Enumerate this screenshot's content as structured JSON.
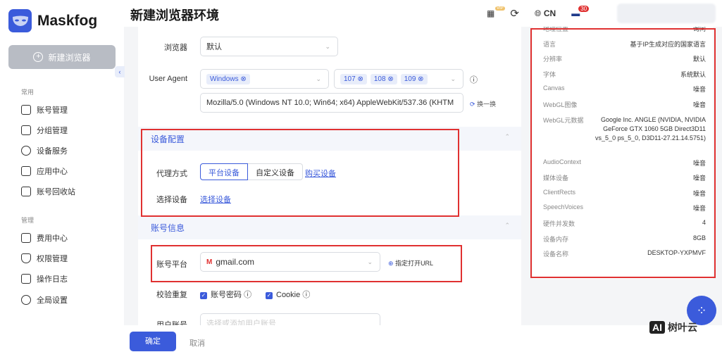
{
  "app": {
    "name": "Maskfog",
    "new_browser": "新建浏览器"
  },
  "sidebar": {
    "groups": [
      {
        "label": "常用",
        "items": [
          {
            "label": "账号管理"
          },
          {
            "label": "分组管理"
          },
          {
            "label": "设备服务"
          },
          {
            "label": "应用中心"
          },
          {
            "label": "账号回收站"
          }
        ]
      },
      {
        "label": "管理",
        "items": [
          {
            "label": "费用中心"
          },
          {
            "label": "权限管理"
          },
          {
            "label": "操作日志"
          },
          {
            "label": "全局设置"
          }
        ]
      }
    ]
  },
  "header": {
    "title": "新建浏览器环境",
    "vip": "VIP",
    "language": "CN",
    "notifications": "30"
  },
  "form": {
    "browser": {
      "label": "浏览器",
      "value": "默认"
    },
    "user_agent": {
      "label": "User Agent",
      "os_tags": [
        "Windows"
      ],
      "version_tags": [
        "107",
        "108",
        "109"
      ],
      "value": "Mozilla/5.0 (Windows NT 10.0; Win64; x64) AppleWebKit/537.36 (KHTM",
      "refresh": "换一换"
    },
    "device_section": {
      "title": "设备配置",
      "proxy_label": "代理方式",
      "options": [
        "平台设备",
        "自定义设备"
      ],
      "buy": "购买设备",
      "select_label": "选择设备",
      "select_link": "选择设备"
    },
    "account_section": {
      "title": "账号信息",
      "platform_label": "账号平台",
      "platform_value": "gmail.com",
      "open_url": "指定打开URL",
      "dup_label": "校验重复",
      "dup_options": [
        "账号密码",
        "Cookie"
      ],
      "user_label": "用户账号",
      "user_placeholder": "选择或添加用户账号"
    }
  },
  "footer": {
    "ok": "确定",
    "cancel": "取消"
  },
  "fingerprint": [
    {
      "k": "地理位置",
      "v": "询问"
    },
    {
      "k": "语言",
      "v": "基于IP生成对应的国家语言"
    },
    {
      "k": "分辨率",
      "v": "默认"
    },
    {
      "k": "字体",
      "v": "系统默认"
    },
    {
      "k": "Canvas",
      "v": "噪音"
    },
    {
      "k": "WebGL图像",
      "v": "噪音"
    },
    {
      "k": "WebGL元数据",
      "v": "Google Inc. ANGLE (NVIDIA, NVIDIA GeForce GTX 1060 5GB Direct3D11 vs_5_0 ps_5_0, D3D11-27.21.14.5751)"
    },
    {
      "k": "AudioContext",
      "v": "噪音"
    },
    {
      "k": "媒体设备",
      "v": "噪音"
    },
    {
      "k": "ClientRects",
      "v": "噪音"
    },
    {
      "k": "SpeechVoices",
      "v": "噪音"
    },
    {
      "k": "硬件并发数",
      "v": "4"
    },
    {
      "k": "设备内存",
      "v": "8GB"
    },
    {
      "k": "设备名称",
      "v": "DESKTOP-YXPMVF"
    }
  ],
  "watermark": {
    "ai": "AI",
    "text": "树叶云"
  }
}
